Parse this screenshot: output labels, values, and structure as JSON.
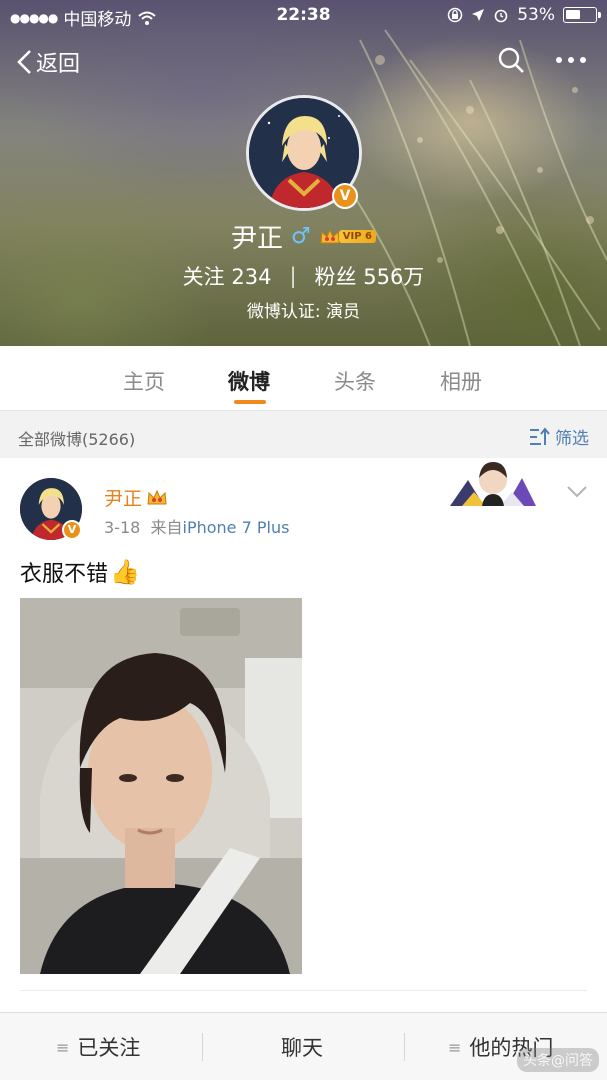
{
  "status_bar": {
    "signal": "●●●●●",
    "carrier": "中国移动",
    "time": "22:38",
    "battery": "53%",
    "battery_level": 0.53
  },
  "nav": {
    "back_label": "返回"
  },
  "profile": {
    "name": "尹正",
    "gender_symbol": "♂",
    "vip_label": "VIP 6",
    "following_label": "关注",
    "following_count": "234",
    "followers_label": "粉丝",
    "followers_count": "556万",
    "certification": "微博认证: 演员",
    "verified_mark": "V"
  },
  "tabs": [
    {
      "label": "主页",
      "active": false
    },
    {
      "label": "微博",
      "active": true
    },
    {
      "label": "头条",
      "active": false
    },
    {
      "label": "相册",
      "active": false
    }
  ],
  "filter": {
    "all_posts_label": "全部微博(5266)",
    "filter_label": "筛选"
  },
  "post": {
    "author": "尹正",
    "date": "3-18",
    "source_prefix": "来自",
    "source": "iPhone 7 Plus",
    "text": "衣服不错",
    "emoji": "👍"
  },
  "bottom_bar": {
    "follow_label": "已关注",
    "chat_label": "聊天",
    "hot_label": "他的热门"
  },
  "watermark": "头条@问答",
  "colors": {
    "accent_orange": "#f08a1c",
    "link_blue": "#4f7fb4",
    "verified_orange": "#e8921b"
  }
}
